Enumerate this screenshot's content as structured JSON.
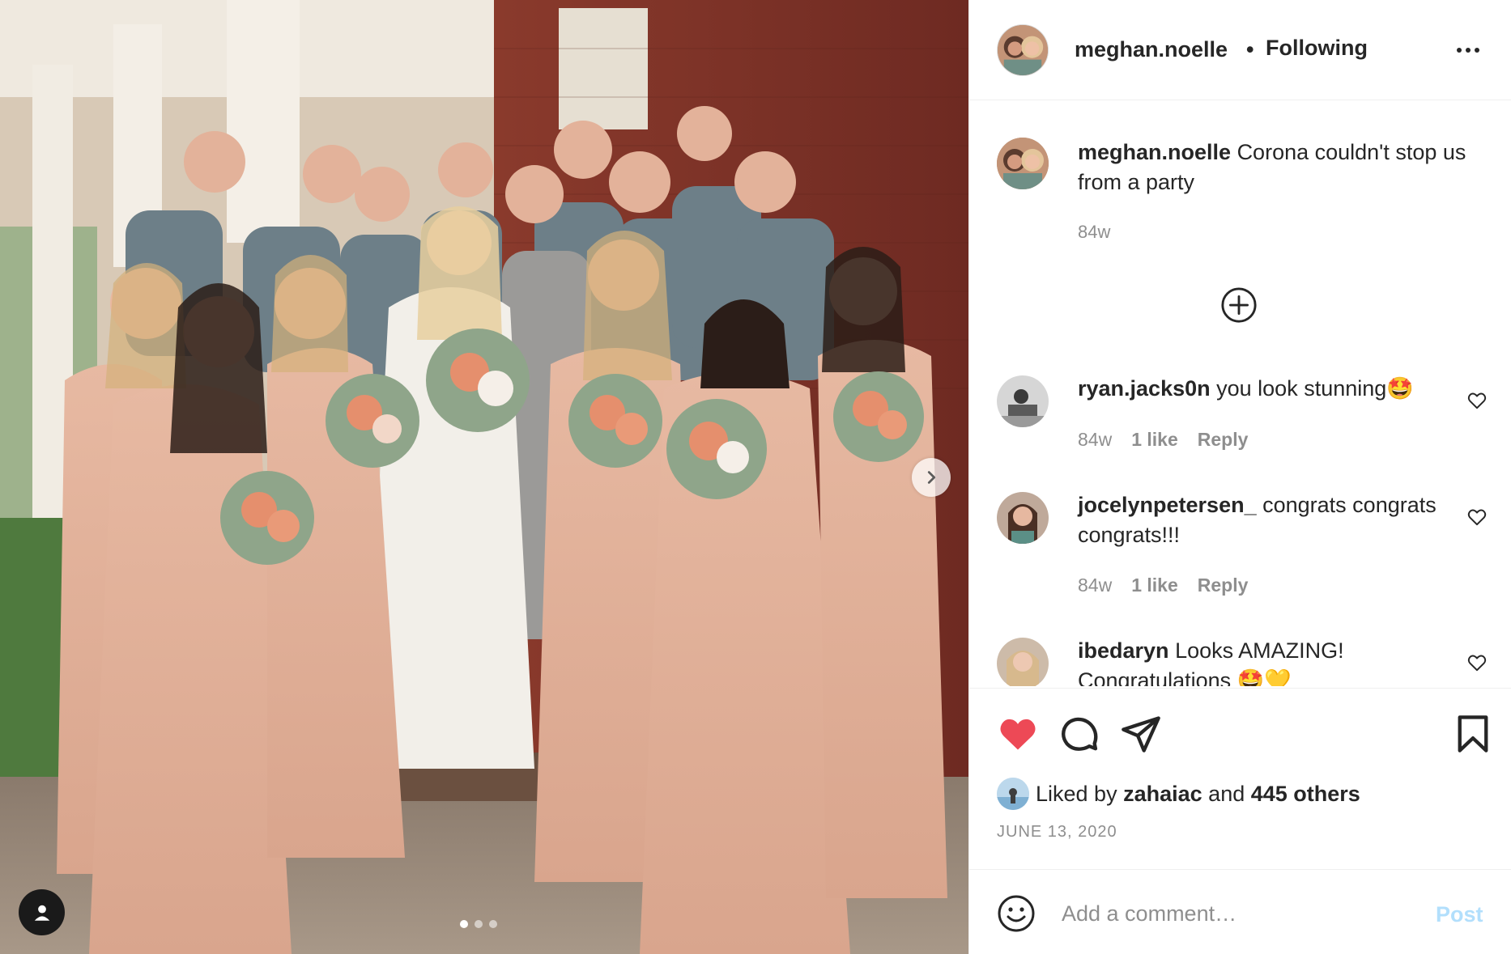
{
  "photo": {
    "alt_desc_icon": "wedding-party-photo",
    "carousel": {
      "count": 3,
      "active_index": 0
    },
    "next_arrow_icon": "chevron-right-icon",
    "tag_icon": "user-tag-icon"
  },
  "header": {
    "username": "meghan.noelle",
    "separator": "•",
    "follow_status": "Following",
    "more_icon": "more-options-icon"
  },
  "caption": {
    "username": "meghan.noelle",
    "text": "Corona couldn't stop us from a party",
    "time": "84w"
  },
  "load_more_icon": "plus-circle-icon",
  "comments": [
    {
      "username": "ryan.jacks0n",
      "text": "you look stunning🤩",
      "time": "84w",
      "likes": "1 like",
      "reply": "Reply"
    },
    {
      "username": "jocelynpetersen_",
      "text": "congrats congrats congrats!!!",
      "time": "84w",
      "likes": "1 like",
      "reply": "Reply"
    },
    {
      "username": "ibedaryn",
      "text": "Looks AMAZING! Congratulations 🤩💛",
      "time": "",
      "likes": "",
      "reply": ""
    }
  ],
  "actions": {
    "like_icon": "heart-filled-icon",
    "comment_icon": "comment-icon",
    "share_icon": "share-icon",
    "save_icon": "bookmark-icon",
    "like_color": "#ed4956"
  },
  "likes": {
    "prefix": "Liked by",
    "user": "zahaiac",
    "conj": "and",
    "others": "445 others"
  },
  "date": "JUNE 13, 2020",
  "add_comment": {
    "placeholder": "Add a comment…",
    "post_label": "Post",
    "emoji_icon": "emoji-icon"
  },
  "colors": {
    "text": "#262626",
    "muted": "#8e8e8e",
    "post_disabled": "#b2dffc",
    "divider": "#efefef"
  }
}
